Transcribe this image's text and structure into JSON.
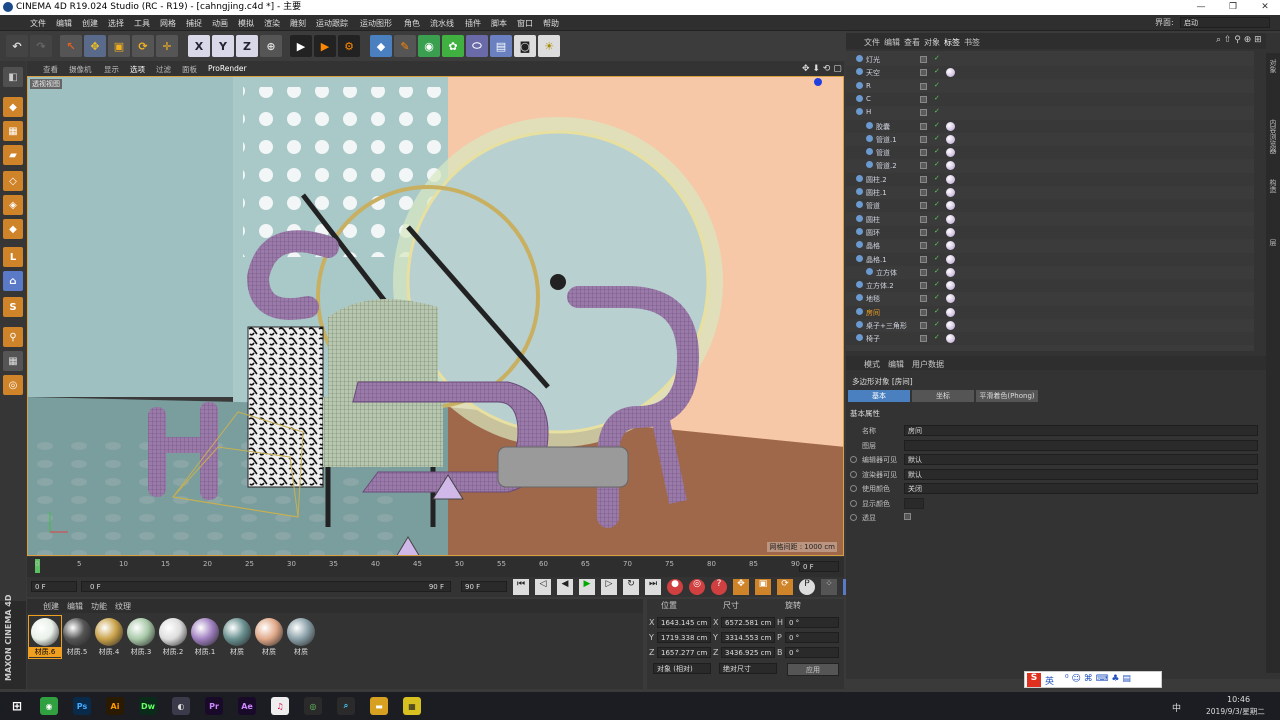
{
  "window": {
    "title": "CINEMA 4D R19.024 Studio (RC - R19) - [cahngjing.c4d *] - 主要"
  },
  "menu": [
    "文件",
    "编辑",
    "创建",
    "选择",
    "工具",
    "网格",
    "捕捉",
    "动画",
    "模拟",
    "渲染",
    "雕刻",
    "运动跟踪",
    "运动图形",
    "角色",
    "流水线",
    "插件",
    "脚本",
    "窗口",
    "帮助"
  ],
  "layout_label": "界面:",
  "layout_value": "启动",
  "viewport_menu": [
    "查看",
    "摄像机",
    "显示",
    "选项",
    "过滤",
    "面板",
    "ProRender"
  ],
  "viewport_name": "透视视图",
  "grid_spacing": "网格间距 : 1000 cm",
  "timeline": {
    "ticks": [
      "0",
      "5",
      "10",
      "15",
      "20",
      "25",
      "30",
      "35",
      "40",
      "45",
      "50",
      "55",
      "60",
      "65",
      "70",
      "75",
      "80",
      "85",
      "90"
    ],
    "frame_end_box": "0 F"
  },
  "transport": {
    "start": "0 F",
    "range_start": "0 F",
    "range_end": "90 F",
    "end": "90 F"
  },
  "material_menu": [
    "创建",
    "编辑",
    "功能",
    "纹理"
  ],
  "materials": [
    {
      "name": "材质.6",
      "color": "#e8f0e8",
      "selected": true
    },
    {
      "name": "材质.5",
      "color": "#555"
    },
    {
      "name": "材质.4",
      "color": "#c9a24a"
    },
    {
      "name": "材质.3",
      "color": "#a8c8a8"
    },
    {
      "name": "材质.2",
      "color": "#ddd"
    },
    {
      "name": "材质.1",
      "color": "#a080c0"
    },
    {
      "name": "材质",
      "color": "#6a9090"
    },
    {
      "name": "材质",
      "color": "#e0a888"
    },
    {
      "name": "材质",
      "color": "#8aa0a8"
    }
  ],
  "coords": {
    "headers": [
      "位置",
      "尺寸",
      "旋转"
    ],
    "rows": [
      {
        "axis": "X",
        "pos": "1643.145 cm",
        "saxis": "X",
        "size": "6572.581 cm",
        "raxis": "H",
        "rot": "0 °"
      },
      {
        "axis": "Y",
        "pos": "1719.338 cm",
        "saxis": "Y",
        "size": "3314.553 cm",
        "raxis": "P",
        "rot": "0 °"
      },
      {
        "axis": "Z",
        "pos": "1657.277 cm",
        "saxis": "Z",
        "size": "3436.925 cm",
        "raxis": "B",
        "rot": "0 °"
      }
    ],
    "mode1": "对象 (相对)",
    "mode2": "绝对尺寸",
    "apply": "应用"
  },
  "object_menu": [
    "文件",
    "编辑",
    "查看",
    "对象",
    "标签",
    "书签"
  ],
  "objects": [
    {
      "name": "灯光",
      "indent": 0
    },
    {
      "name": "天空",
      "indent": 0
    },
    {
      "name": "R",
      "indent": 0
    },
    {
      "name": "C",
      "indent": 0
    },
    {
      "name": "H",
      "indent": 0
    },
    {
      "name": "胶囊",
      "indent": 1
    },
    {
      "name": "管道.1",
      "indent": 1
    },
    {
      "name": "管道",
      "indent": 1
    },
    {
      "name": "管道.2",
      "indent": 1
    },
    {
      "name": "圆柱.2",
      "indent": 0
    },
    {
      "name": "圆柱.1",
      "indent": 0
    },
    {
      "name": "管道",
      "indent": 0
    },
    {
      "name": "圆柱",
      "indent": 0
    },
    {
      "name": "圆环",
      "indent": 0
    },
    {
      "name": "晶格",
      "indent": 0
    },
    {
      "name": "晶格.1",
      "indent": 0
    },
    {
      "name": "立方体",
      "indent": 1
    },
    {
      "name": "立方体.2",
      "indent": 0
    },
    {
      "name": "地毯",
      "indent": 0
    },
    {
      "name": "房间",
      "indent": 0,
      "active": true
    },
    {
      "name": "桌子+三角形",
      "indent": 0
    },
    {
      "name": "椅子",
      "indent": 0
    }
  ],
  "attr_menu": [
    "模式",
    "编辑",
    "用户数据"
  ],
  "attr_title": "多边形对象 [房间]",
  "attr_tabs": [
    "基本",
    "坐标",
    "平滑着色(Phong)"
  ],
  "attr_section": "基本属性",
  "attr_fields": [
    {
      "label": "名称",
      "value": "房间"
    },
    {
      "label": "图层",
      "value": ""
    },
    {
      "label": "编辑器可见",
      "value": "默认"
    },
    {
      "label": "渲染器可见",
      "value": "默认"
    },
    {
      "label": "使用颜色",
      "value": "关闭"
    },
    {
      "label": "显示颜色",
      "value": ""
    },
    {
      "label": "透显",
      "value": ""
    }
  ],
  "side_tabs": [
    "对象",
    "内容浏览器",
    "构造",
    "层"
  ],
  "ime": {
    "label": "英"
  },
  "clock": {
    "time": "10:46",
    "date": "2019/9/3/星期二"
  },
  "tray_lang": "中",
  "brand": "MAXON CINEMA 4D"
}
